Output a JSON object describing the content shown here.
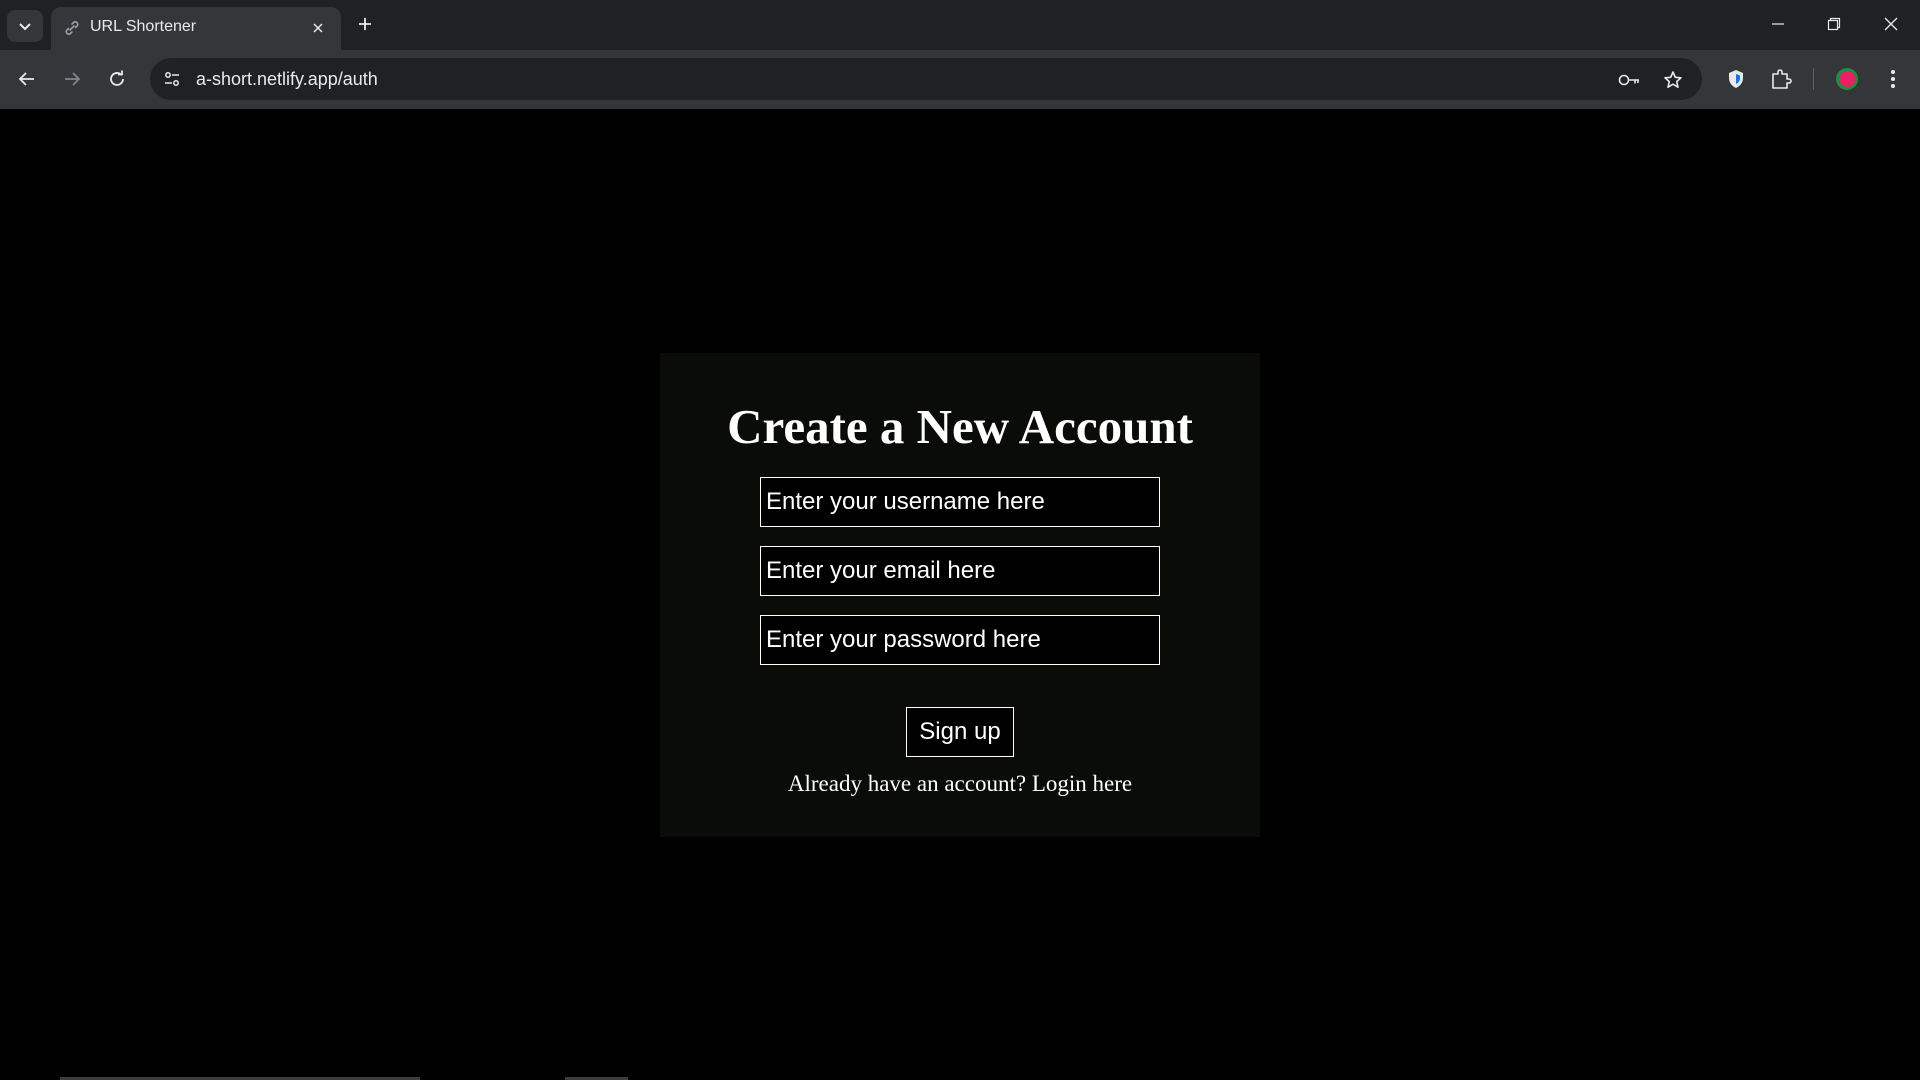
{
  "browser": {
    "tab_title": "URL Shortener",
    "url": "a-short.netlify.app/auth",
    "profile_color": "#e91e63",
    "accent_color": "#1a73e8"
  },
  "form": {
    "heading": "Create a New Account",
    "username_placeholder": "Enter your username here",
    "email_placeholder": "Enter your email here",
    "password_placeholder": "Enter your password here",
    "submit_label": "Sign up",
    "login_prompt": "Already have an account?",
    "login_link": "Login here"
  },
  "icons": [
    "tab-search-icon",
    "link-icon",
    "close-icon",
    "plus-icon",
    "minimize-icon",
    "restore-icon",
    "window-close-icon",
    "back-icon",
    "forward-icon",
    "reload-icon",
    "site-info-icon",
    "password-key-icon",
    "star-icon",
    "shield-icon",
    "extensions-icon",
    "profile-icon",
    "menu-dots-icon"
  ]
}
